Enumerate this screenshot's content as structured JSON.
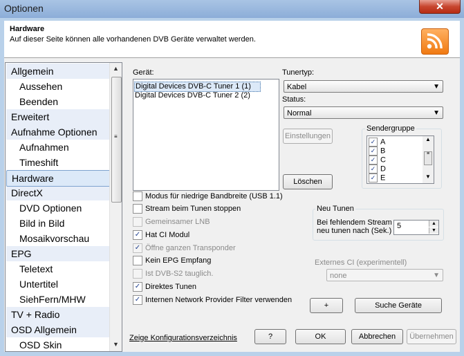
{
  "window": {
    "title": "Optionen",
    "close_glyph": "✕"
  },
  "header": {
    "title": "Hardware",
    "subtitle": "Auf dieser Seite können alle vorhandenen DVB Geräte verwaltet werden.",
    "icon": "rss-icon"
  },
  "nav": {
    "items": [
      {
        "label": "Allgemein",
        "level": 0
      },
      {
        "label": "Aussehen",
        "level": 1
      },
      {
        "label": "Beenden",
        "level": 1
      },
      {
        "label": "Erweitert",
        "level": 0
      },
      {
        "label": "Aufnahme Optionen",
        "level": 0
      },
      {
        "label": "Aufnahmen",
        "level": 1
      },
      {
        "label": "Timeshift",
        "level": 1
      },
      {
        "label": "Hardware",
        "level": 0,
        "selected": true
      },
      {
        "label": "DirectX",
        "level": 0
      },
      {
        "label": "DVD Optionen",
        "level": 1
      },
      {
        "label": "Bild in Bild",
        "level": 1
      },
      {
        "label": "Mosaikvorschau",
        "level": 1
      },
      {
        "label": "EPG",
        "level": 0
      },
      {
        "label": "Teletext",
        "level": 1
      },
      {
        "label": "Untertitel",
        "level": 1
      },
      {
        "label": "SiehFern/MHW",
        "level": 1
      },
      {
        "label": "TV + Radio",
        "level": 0
      },
      {
        "label": "OSD Allgemein",
        "level": 0
      },
      {
        "label": "OSD Skin",
        "level": 1
      }
    ]
  },
  "devices": {
    "label": "Gerät:",
    "items": [
      "Digital Devices DVB-C Tuner 1 (1)",
      "Digital Devices DVB-C Tuner 2 (2)"
    ],
    "selected_index": 0
  },
  "tunertyp": {
    "label": "Tunertyp:",
    "value": "Kabel"
  },
  "status": {
    "label": "Status:",
    "value": "Normal"
  },
  "buttons": {
    "einstellungen": "Einstellungen",
    "loeschen": "Löschen",
    "plus": "+",
    "suche": "Suche Geräte",
    "help": "?",
    "ok": "OK",
    "abbrechen": "Abbrechen",
    "uebernehmen": "Übernehmen"
  },
  "sendergruppe": {
    "label": "Sendergruppe",
    "items": [
      "A",
      "B",
      "C",
      "D",
      "E"
    ]
  },
  "options": [
    {
      "label": "Modus für niedrige Bandbreite (USB 1.1)",
      "checked": false,
      "enabled": true
    },
    {
      "label": "Stream beim Tunen stoppen",
      "checked": false,
      "enabled": true
    },
    {
      "label": "Gemeinsamer LNB",
      "checked": false,
      "enabled": false
    },
    {
      "label": "Hat CI Modul",
      "checked": true,
      "enabled": true
    },
    {
      "label": "Öffne ganzen Transponder",
      "checked": true,
      "enabled": false
    },
    {
      "label": "Kein EPG Empfang",
      "checked": false,
      "enabled": true
    },
    {
      "label": "Ist DVB-S2 tauglich.",
      "checked": false,
      "enabled": false
    },
    {
      "label": "Direktes Tunen",
      "checked": true,
      "enabled": true
    },
    {
      "label": "Internen Network Provider Filter verwenden",
      "checked": true,
      "enabled": true
    }
  ],
  "neu_tunen": {
    "title": "Neu Tunen",
    "line1": "Bei fehlendem Stream",
    "line2": "neu tunen nach (Sek.)",
    "value": "5"
  },
  "externes_ci": {
    "label": "Externes CI (experimentell)",
    "value": "none"
  },
  "config_link": "Zeige Konfigurationsverzeichnis"
}
